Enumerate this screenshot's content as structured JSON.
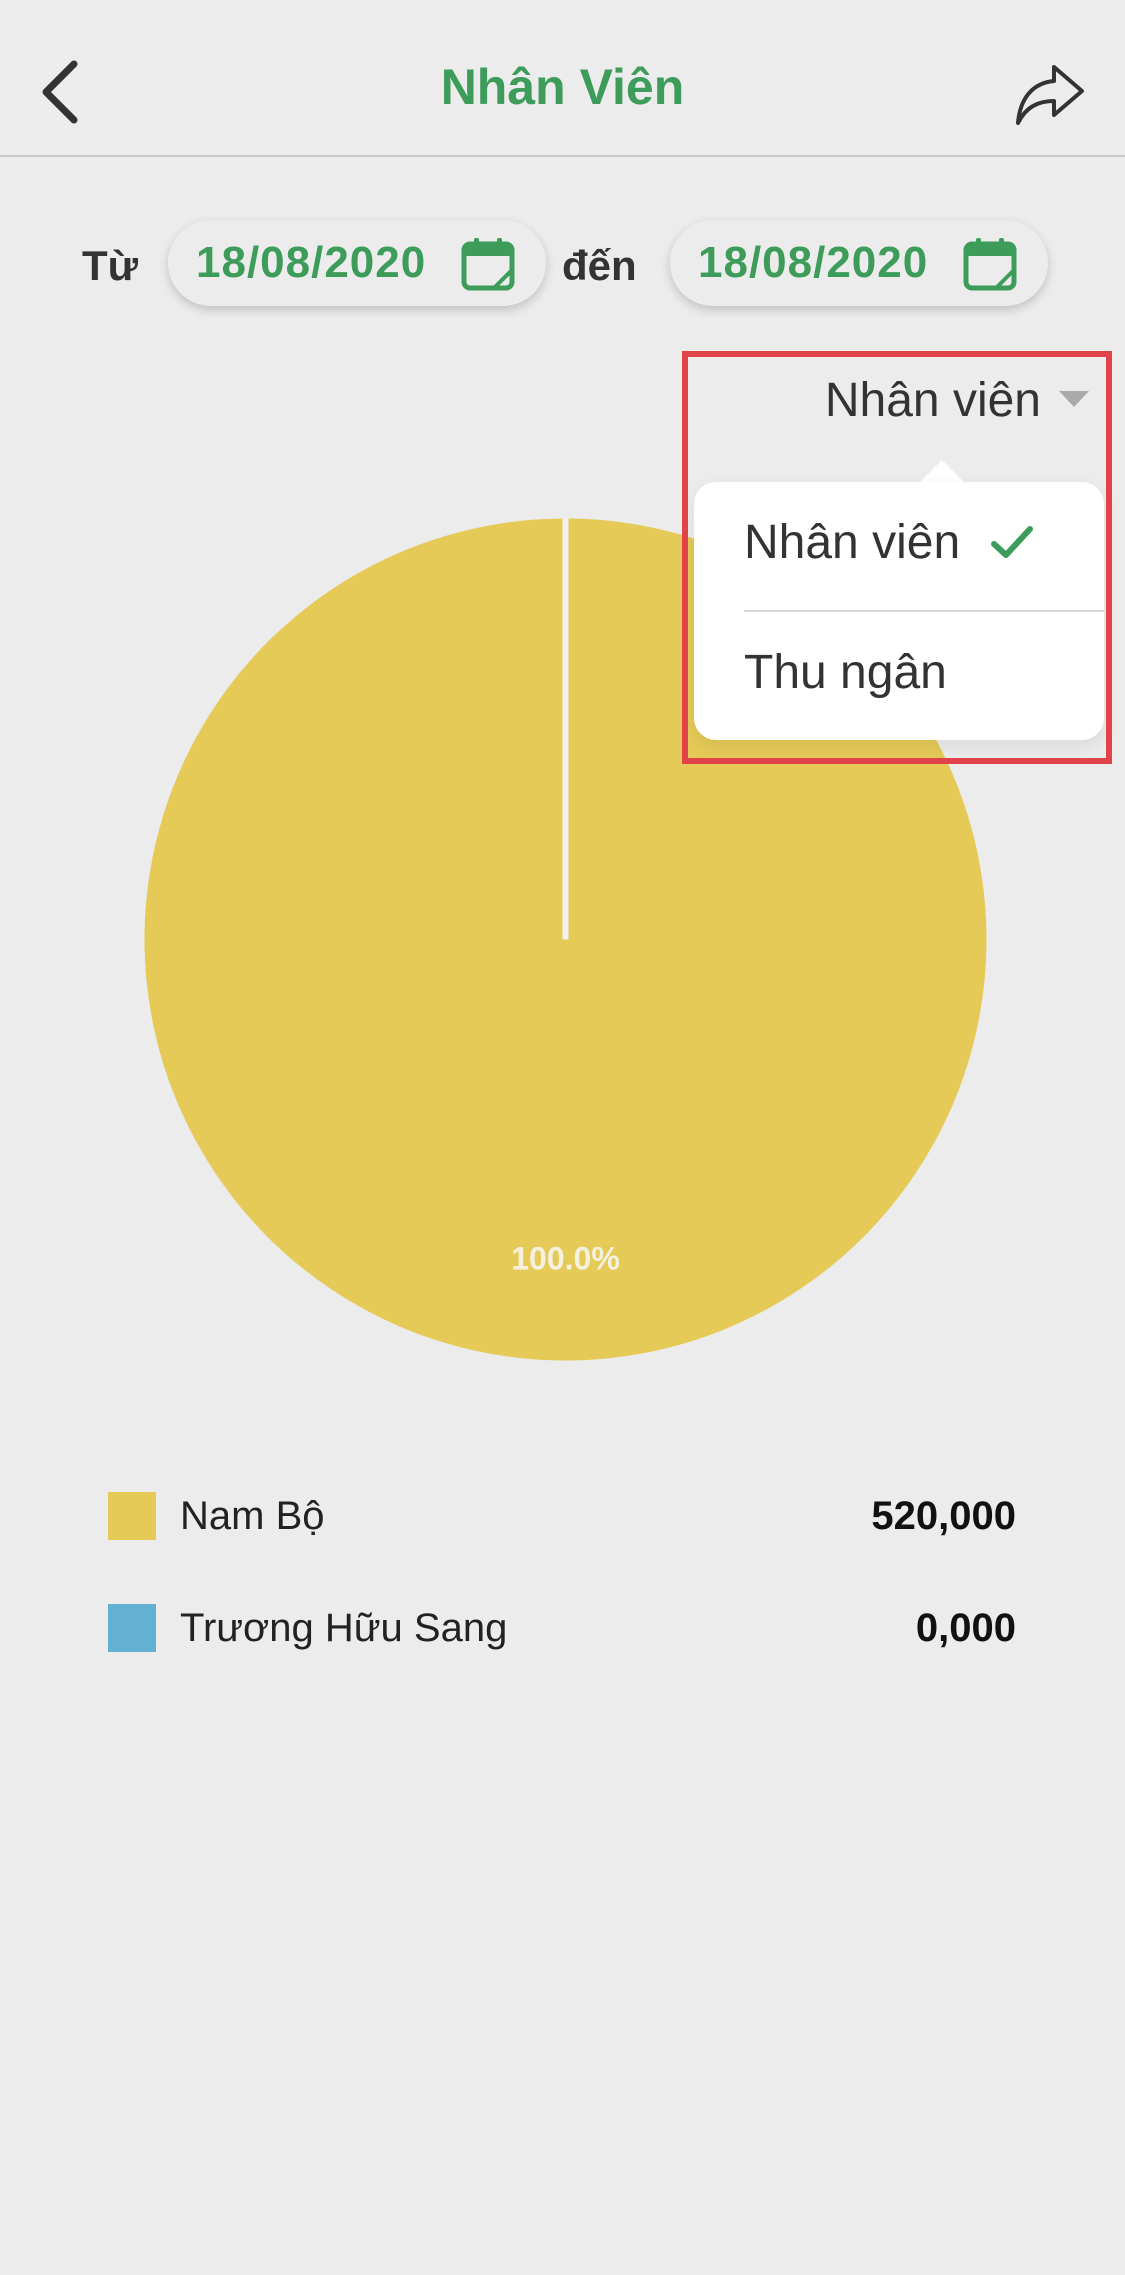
{
  "header": {
    "title": "Nhân Viên",
    "back_icon": "chevron-left-icon",
    "share_icon": "share-icon"
  },
  "date_range": {
    "from_label": "Từ",
    "from_value": "18/08/2020",
    "to_label": "đến",
    "to_value": "18/08/2020",
    "calendar_icon": "calendar-icon"
  },
  "filter": {
    "selected": "Nhân viên",
    "options": [
      {
        "label": "Nhân viên",
        "selected": true
      },
      {
        "label": "Thu ngân",
        "selected": false
      }
    ]
  },
  "colors": {
    "accent": "#3d9c5a",
    "highlight": "#e0434a"
  },
  "chart_data": {
    "type": "pie",
    "slices": [
      {
        "name": "Nam Bộ",
        "value": 520000,
        "percent": 100.0,
        "color": "#e5ca58"
      },
      {
        "name": "Trương Hữu Sang",
        "value": 0,
        "percent": 0.0,
        "color": "#62b1d3"
      }
    ],
    "data_labels": [
      "100.0%"
    ]
  },
  "legend": [
    {
      "name": "Nam Bộ",
      "value": "520,000",
      "color": "#e5ca58"
    },
    {
      "name": "Trương Hữu Sang",
      "value": "0,000",
      "color": "#62b1d3"
    }
  ]
}
